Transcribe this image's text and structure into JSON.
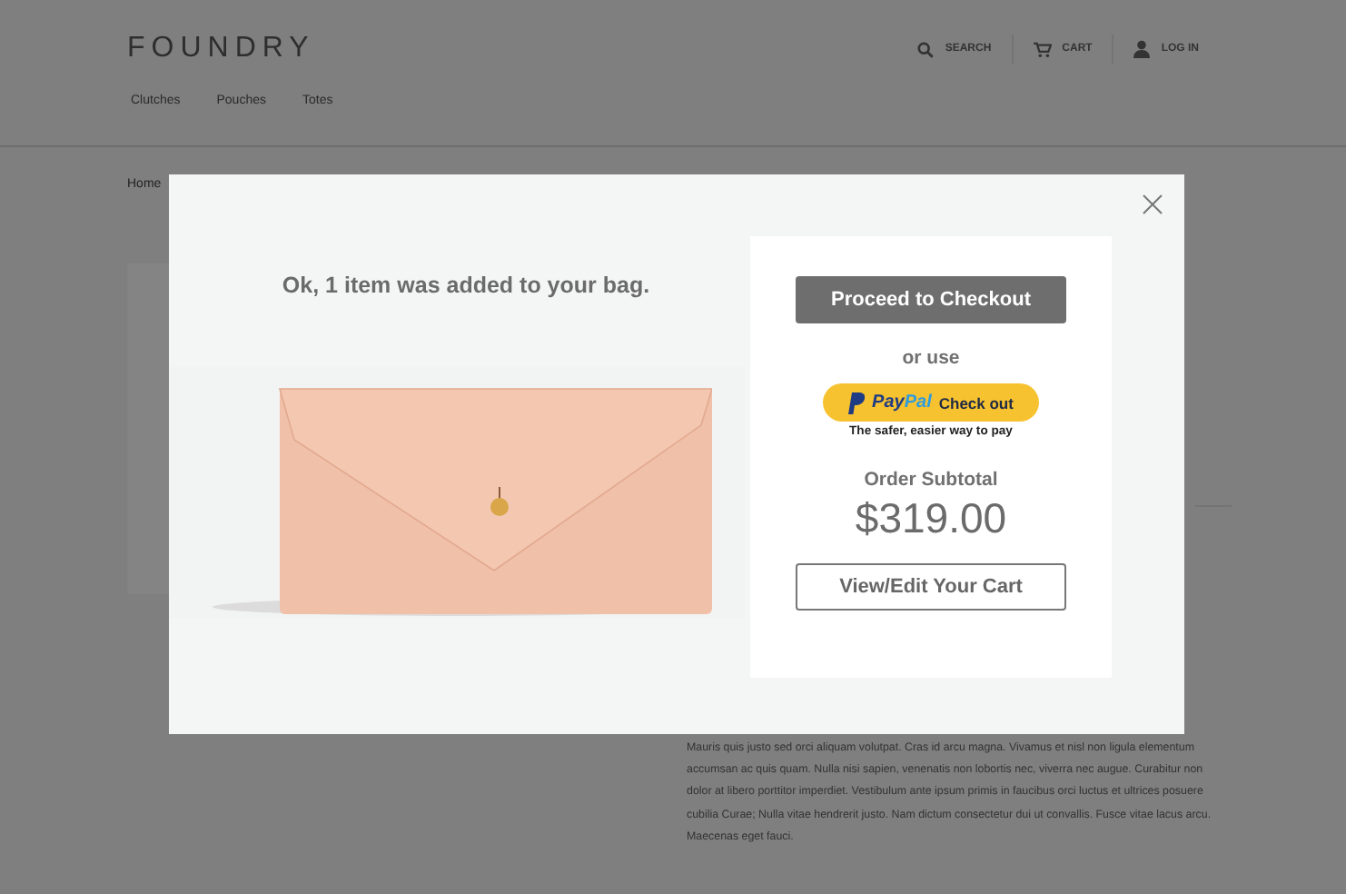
{
  "header": {
    "logo": "FOUNDRY",
    "nav": [
      "Clutches",
      "Pouches",
      "Totes"
    ],
    "actions": [
      {
        "kind": "search",
        "label": "SEARCH"
      },
      {
        "kind": "cart",
        "label": "CART"
      },
      {
        "kind": "user",
        "label": "LOG IN"
      }
    ]
  },
  "breadcrumb": [
    "Home"
  ],
  "description": "Mauris quis justo sed orci aliquam volutpat. Cras id arcu magna. Vivamus et nisl non ligula elementum accumsan ac quis quam. Nulla nisi sapien, venenatis non lobortis nec, viverra nec augue. Curabitur non dolor at libero porttitor imperdiet. Vestibulum ante ipsum primis in faucibus orci luctus et ultrices posuere cubilia Curae; Nulla vitae hendrerit justo. Nam dictum consectetur dui ut convallis. Fusce vitae lacus arcu. Maecenas eget fauci.",
  "modal": {
    "message": "Ok, 1 item was added to your bag.",
    "checkout_button": "Proceed to Checkout",
    "or_use": "or use",
    "paypal": {
      "logo": [
        "Pay",
        "Pal"
      ],
      "label": "Check out",
      "tagline": "The safer, easier way to pay"
    },
    "subtotal_label": "Order Subtotal",
    "subtotal": "$319.00",
    "cart_button": "View/Edit Your Cart"
  }
}
